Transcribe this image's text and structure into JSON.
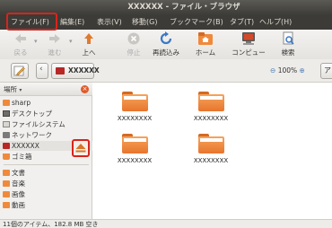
{
  "window": {
    "title": "XXXXXX - ファイル・ブラウザ"
  },
  "menu": [
    {
      "label": "ファイル(F)"
    },
    {
      "label": "編集(E)"
    },
    {
      "label": "表示(V)"
    },
    {
      "label": "移動(G)"
    },
    {
      "label": "ブックマーク(B)"
    },
    {
      "label": "タブ(T)"
    },
    {
      "label": "ヘルプ(H)"
    }
  ],
  "toolbar": {
    "back": "戻る",
    "forward": "進む",
    "up": "上へ",
    "stop": "停止",
    "reload": "再読込み",
    "home": "ホーム",
    "computer": "コンピュータ",
    "search": "検索"
  },
  "location": {
    "current": "XXXXXX",
    "zoom": "100%"
  },
  "sidebar": {
    "header": "場所",
    "items": [
      {
        "label": "sharp",
        "icon": "home-folder-icon"
      },
      {
        "label": "デスクトップ",
        "icon": "desktop-icon"
      },
      {
        "label": "ファイルシステム",
        "icon": "drive-icon"
      },
      {
        "label": "ネットワーク",
        "icon": "network-icon"
      },
      {
        "label": "XXXXXX",
        "icon": "removable-media-icon"
      },
      {
        "label": "ゴミ箱",
        "icon": "trash-icon"
      },
      {
        "label": "文書",
        "icon": "folder-icon"
      },
      {
        "label": "音楽",
        "icon": "folder-icon"
      },
      {
        "label": "画像",
        "icon": "folder-icon"
      },
      {
        "label": "動画",
        "icon": "folder-icon"
      }
    ]
  },
  "files": [
    {
      "name": "XXXXXXXX"
    },
    {
      "name": "XXXXXXXX"
    },
    {
      "name": "XXXXXXXX"
    },
    {
      "name": "XXXXXXXX"
    }
  ],
  "status": "11個のアイテム、182.8 MB 空き",
  "colors": {
    "highlight": "#d8241c",
    "folder": "#ef8a3c"
  }
}
